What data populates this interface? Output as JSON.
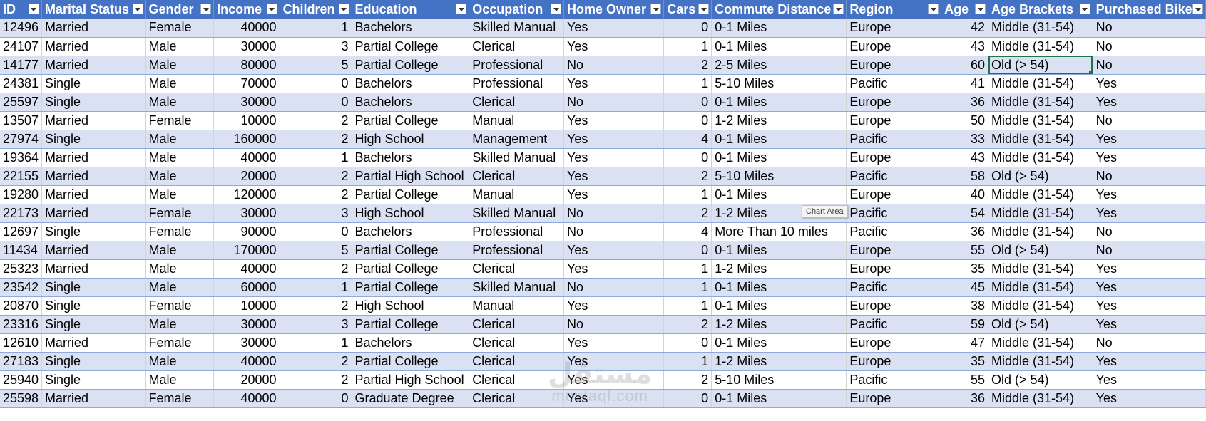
{
  "colors": {
    "header_bg": "#4472c4",
    "header_text": "#ffffff",
    "band_row": "#d9e1f2",
    "plain_row": "#ffffff",
    "selection": "#217346"
  },
  "columns": [
    "ID",
    "Marital Status",
    "Gender",
    "Income",
    "Children",
    "Education",
    "Occupation",
    "Home Owner",
    "Cars",
    "Commute Distance",
    "Region",
    "Age",
    "Age Brackets",
    "Purchased Bike"
  ],
  "numeric_columns": [
    0,
    3,
    4,
    8,
    11
  ],
  "selected_cell": {
    "row": 2,
    "col": 12
  },
  "rows": [
    [
      "12496",
      "Married",
      "Female",
      "40000",
      "1",
      "Bachelors",
      "Skilled Manual",
      "Yes",
      "0",
      "0-1 Miles",
      "Europe",
      "42",
      "Middle (31-54)",
      "No"
    ],
    [
      "24107",
      "Married",
      "Male",
      "30000",
      "3",
      "Partial College",
      "Clerical",
      "Yes",
      "1",
      "0-1 Miles",
      "Europe",
      "43",
      "Middle (31-54)",
      "No"
    ],
    [
      "14177",
      "Married",
      "Male",
      "80000",
      "5",
      "Partial College",
      "Professional",
      "No",
      "2",
      "2-5 Miles",
      "Europe",
      "60",
      "Old (> 54)",
      "No"
    ],
    [
      "24381",
      "Single",
      "Male",
      "70000",
      "0",
      "Bachelors",
      "Professional",
      "Yes",
      "1",
      "5-10 Miles",
      "Pacific",
      "41",
      "Middle (31-54)",
      "Yes"
    ],
    [
      "25597",
      "Single",
      "Male",
      "30000",
      "0",
      "Bachelors",
      "Clerical",
      "No",
      "0",
      "0-1 Miles",
      "Europe",
      "36",
      "Middle (31-54)",
      "Yes"
    ],
    [
      "13507",
      "Married",
      "Female",
      "10000",
      "2",
      "Partial College",
      "Manual",
      "Yes",
      "0",
      "1-2 Miles",
      "Europe",
      "50",
      "Middle (31-54)",
      "No"
    ],
    [
      "27974",
      "Single",
      "Male",
      "160000",
      "2",
      "High School",
      "Management",
      "Yes",
      "4",
      "0-1 Miles",
      "Pacific",
      "33",
      "Middle (31-54)",
      "Yes"
    ],
    [
      "19364",
      "Married",
      "Male",
      "40000",
      "1",
      "Bachelors",
      "Skilled Manual",
      "Yes",
      "0",
      "0-1 Miles",
      "Europe",
      "43",
      "Middle (31-54)",
      "Yes"
    ],
    [
      "22155",
      "Married",
      "Male",
      "20000",
      "2",
      "Partial High School",
      "Clerical",
      "Yes",
      "2",
      "5-10 Miles",
      "Pacific",
      "58",
      "Old (> 54)",
      "No"
    ],
    [
      "19280",
      "Married",
      "Male",
      "120000",
      "2",
      "Partial College",
      "Manual",
      "Yes",
      "1",
      "0-1 Miles",
      "Europe",
      "40",
      "Middle (31-54)",
      "Yes"
    ],
    [
      "22173",
      "Married",
      "Female",
      "30000",
      "3",
      "High School",
      "Skilled Manual",
      "No",
      "2",
      "1-2 Miles",
      "Pacific",
      "54",
      "Middle (31-54)",
      "Yes"
    ],
    [
      "12697",
      "Single",
      "Female",
      "90000",
      "0",
      "Bachelors",
      "Professional",
      "No",
      "4",
      "More Than 10 miles",
      "Pacific",
      "36",
      "Middle (31-54)",
      "No"
    ],
    [
      "11434",
      "Married",
      "Male",
      "170000",
      "5",
      "Partial College",
      "Professional",
      "Yes",
      "0",
      "0-1 Miles",
      "Europe",
      "55",
      "Old (> 54)",
      "No"
    ],
    [
      "25323",
      "Married",
      "Male",
      "40000",
      "2",
      "Partial College",
      "Clerical",
      "Yes",
      "1",
      "1-2 Miles",
      "Europe",
      "35",
      "Middle (31-54)",
      "Yes"
    ],
    [
      "23542",
      "Single",
      "Male",
      "60000",
      "1",
      "Partial College",
      "Skilled Manual",
      "No",
      "1",
      "0-1 Miles",
      "Pacific",
      "45",
      "Middle (31-54)",
      "Yes"
    ],
    [
      "20870",
      "Single",
      "Female",
      "10000",
      "2",
      "High School",
      "Manual",
      "Yes",
      "1",
      "0-1 Miles",
      "Europe",
      "38",
      "Middle (31-54)",
      "Yes"
    ],
    [
      "23316",
      "Single",
      "Male",
      "30000",
      "3",
      "Partial College",
      "Clerical",
      "No",
      "2",
      "1-2 Miles",
      "Pacific",
      "59",
      "Old (> 54)",
      "Yes"
    ],
    [
      "12610",
      "Married",
      "Female",
      "30000",
      "1",
      "Bachelors",
      "Clerical",
      "Yes",
      "0",
      "0-1 Miles",
      "Europe",
      "47",
      "Middle (31-54)",
      "No"
    ],
    [
      "27183",
      "Single",
      "Male",
      "40000",
      "2",
      "Partial College",
      "Clerical",
      "Yes",
      "1",
      "1-2 Miles",
      "Europe",
      "35",
      "Middle (31-54)",
      "Yes"
    ],
    [
      "25940",
      "Single",
      "Male",
      "20000",
      "2",
      "Partial High School",
      "Clerical",
      "Yes",
      "2",
      "5-10 Miles",
      "Pacific",
      "55",
      "Old (> 54)",
      "Yes"
    ],
    [
      "25598",
      "Married",
      "Female",
      "40000",
      "0",
      "Graduate Degree",
      "Clerical",
      "Yes",
      "0",
      "0-1 Miles",
      "Europe",
      "36",
      "Middle (31-54)",
      "Yes"
    ]
  ],
  "tooltip": {
    "text": "Chart Area"
  },
  "watermark": {
    "arabic": "مستقل",
    "latin": "mostaql.com"
  }
}
